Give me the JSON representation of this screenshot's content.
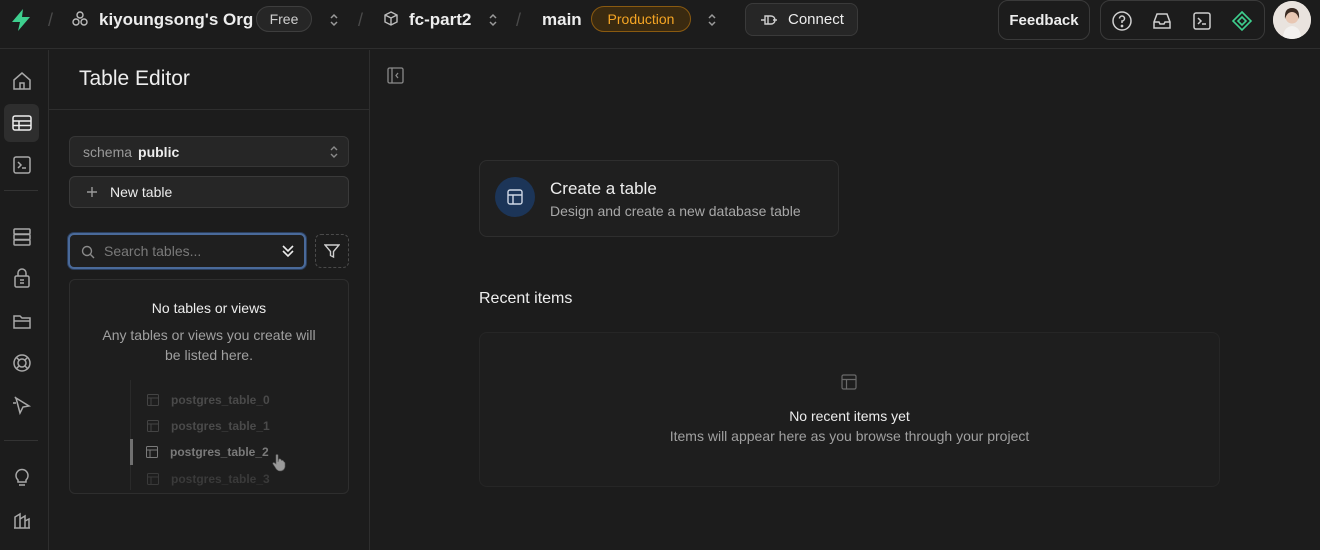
{
  "topbar": {
    "org_name": "kiyoungsong's Org",
    "plan": "Free",
    "project": "fc-part2",
    "branch": "main",
    "environment": "Production",
    "connect_label": "Connect",
    "feedback_label": "Feedback"
  },
  "colors": {
    "accent": "#3ecf8e",
    "production": "#f5a524",
    "focus_ring": "#4a6a9a",
    "create_icon_bg": "#1c3558"
  },
  "rail": {
    "items": [
      "home-icon",
      "table-editor-icon",
      "sql-editor-icon",
      "database-icon",
      "auth-icon",
      "storage-icon",
      "realtime-icon",
      "edge-functions-icon",
      "advisors-icon",
      "reports-icon"
    ],
    "active": "table-editor-icon"
  },
  "side": {
    "title": "Table Editor",
    "schema_label": "schema",
    "schema_value": "public",
    "new_table_label": "New table",
    "search_placeholder": "Search tables...",
    "empty_title": "No tables or views",
    "empty_desc": "Any tables or views you create will be listed here.",
    "ghost_tables": [
      "postgres_table_0",
      "postgres_table_1",
      "postgres_table_2",
      "postgres_table_3"
    ],
    "ghost_highlighted": "postgres_table_2"
  },
  "main": {
    "create_title": "Create a table",
    "create_desc": "Design and create a new database table",
    "recent_title": "Recent items",
    "recent_empty_title": "No recent items yet",
    "recent_empty_desc": "Items will appear here as you browse through your project"
  }
}
